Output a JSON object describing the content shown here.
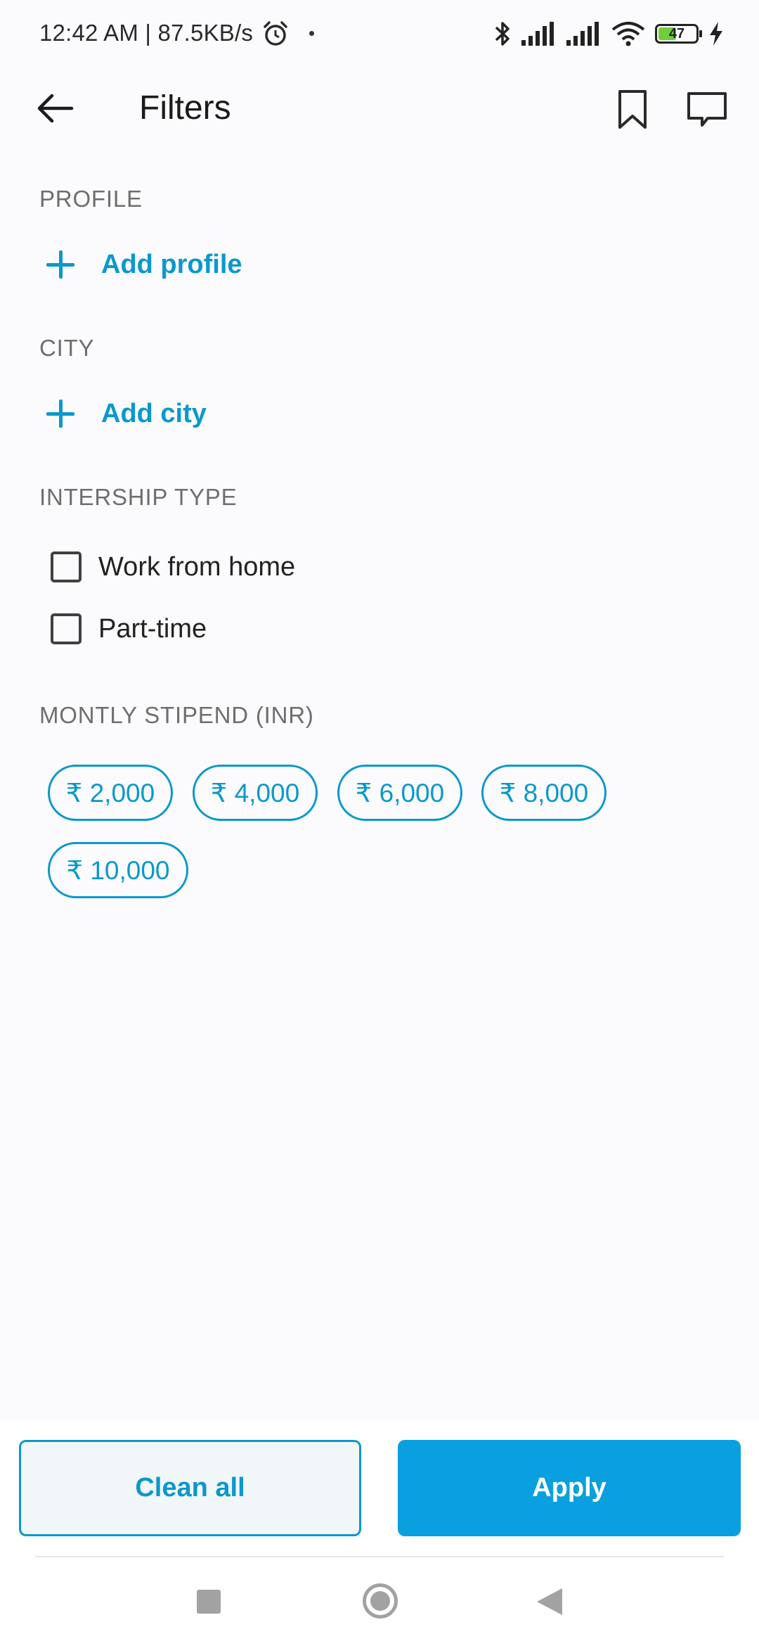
{
  "status_bar": {
    "time_speed": "12:42 AM | 87.5KB/s",
    "battery_level": "47",
    "icons": [
      "alarm-icon",
      "bluetooth-icon",
      "signal-icon",
      "signal-icon",
      "wifi-icon",
      "battery-icon",
      "charging-icon"
    ]
  },
  "app_bar": {
    "title": "Filters",
    "icons": [
      "back-arrow-icon",
      "bookmark-icon",
      "chat-icon"
    ]
  },
  "profile": {
    "label": "PROFILE",
    "add_label": "Add profile"
  },
  "city": {
    "label": "CITY",
    "add_label": "Add city"
  },
  "internship_type": {
    "label": "INTERSHIP TYPE",
    "options": [
      {
        "label": "Work from home",
        "checked": false
      },
      {
        "label": "Part-time",
        "checked": false
      }
    ]
  },
  "stipend": {
    "label": "MONTLY STIPEND (INR)",
    "options": [
      "₹ 2,000",
      "₹ 4,000",
      "₹ 6,000",
      "₹ 8,000",
      "₹ 10,000"
    ]
  },
  "actions": {
    "clean_label": "Clean all",
    "apply_label": "Apply"
  },
  "colors": {
    "accent": "#0b98cc",
    "apply_bg": "#0aa0e0",
    "background": "#fbfbfd"
  }
}
